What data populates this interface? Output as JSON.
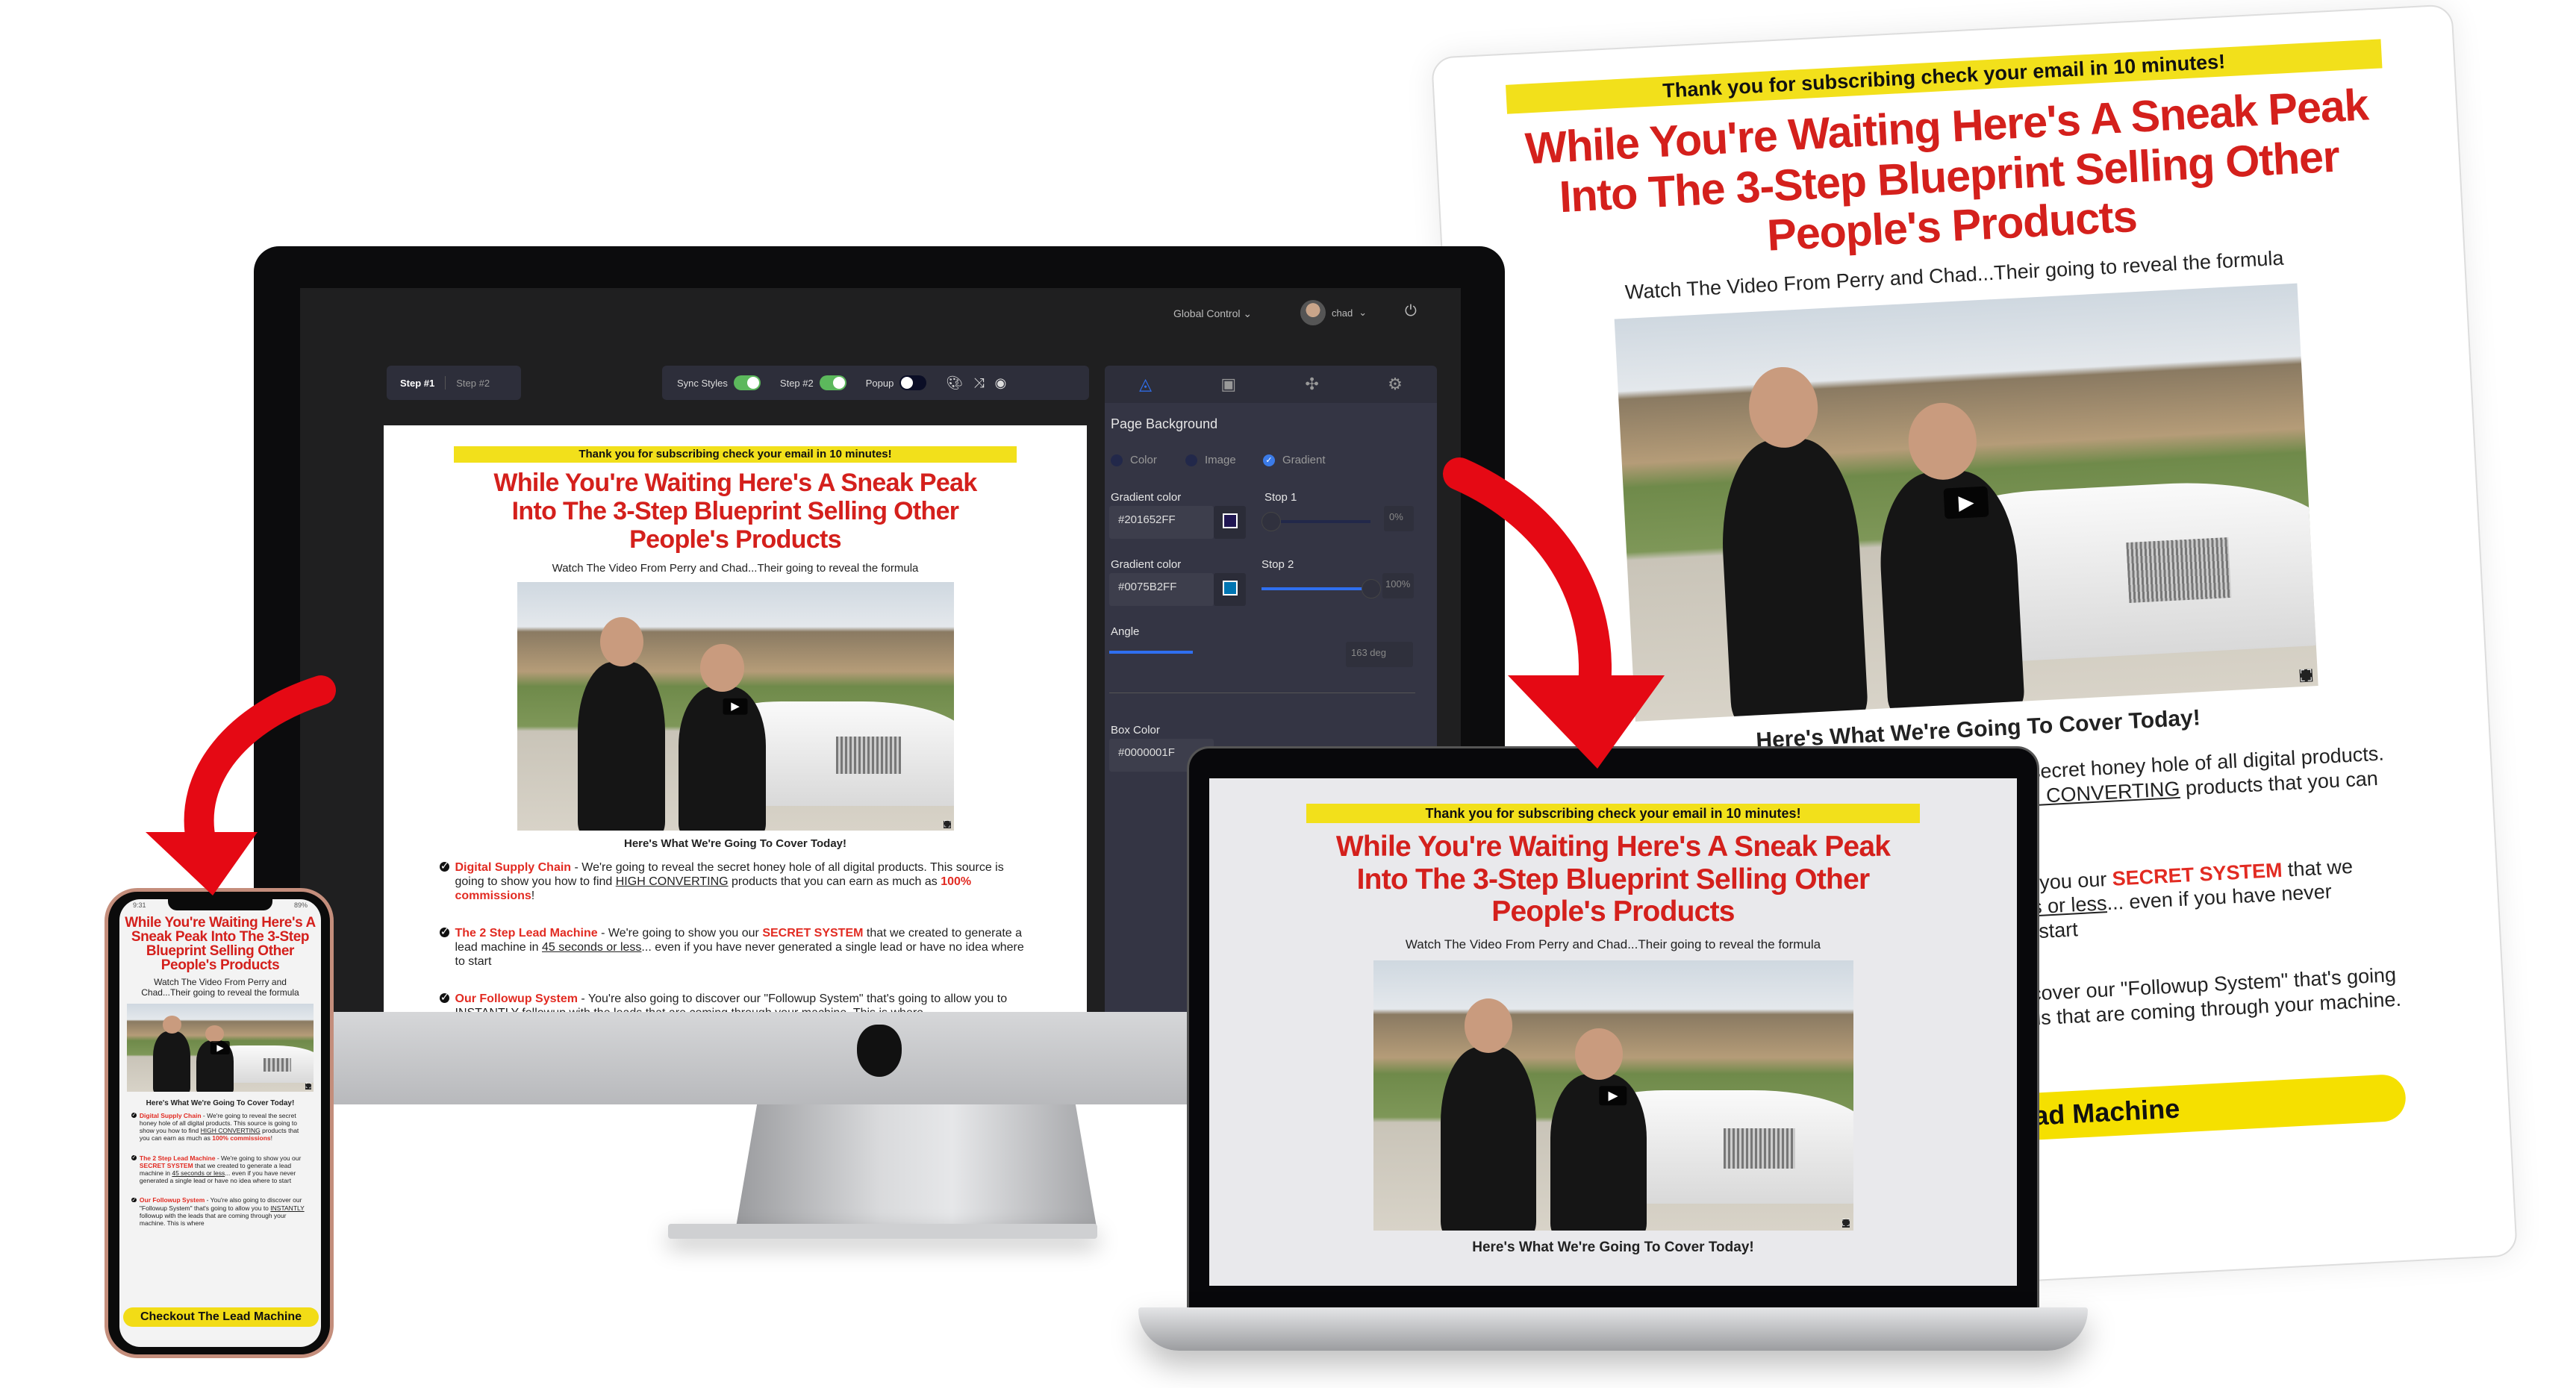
{
  "landing": {
    "thanks": "Thank you for subscribing check your email in 10 minutes!",
    "headline": "While You're Waiting Here's A Sneak Peak Into The 3-Step Blueprint Selling Other People's Products",
    "subtitle": "Watch The Video From Perry and Chad...Their going to reveal the formula",
    "cover_heading": "Here's What We're Going To Cover Today!",
    "bullets": [
      {
        "title": "Digital Supply Chain",
        "t1": " - We're going to reveal the secret honey hole of all digital products.  This source is going to show you how to find ",
        "u1": "HIGH CONVERTING",
        "t2": " products that you can earn as much as ",
        "r2": "100% commissions",
        "t3": "!"
      },
      {
        "title": "The 2 Step Lead Machine",
        "t1": " - We're going to show you our ",
        "r1": "SECRET SYSTEM",
        "t2": " that we created to generate a lead machine in ",
        "u2": "45 seconds or less",
        "t3": "... even if you have never generated a single lead or have no idea where to start"
      },
      {
        "title": "Our Followup System",
        "t1": " - You're also going to discover our \"Followup System\" that's going to allow you to ",
        "u1": "INSTANTLY",
        "t2": " followup with the leads that are coming through your machine.  This is where"
      }
    ],
    "cta": "Checkout The Lead Machine"
  },
  "editor": {
    "global_control": "Global Control",
    "user": "chad",
    "steps": [
      "Step #1",
      "Step #2"
    ],
    "toggles": [
      {
        "label": "Sync Styles",
        "on": true
      },
      {
        "label": "Step #2",
        "on": true
      },
      {
        "label": "Popup",
        "on": false
      }
    ],
    "toolbar_icons": [
      "palette-icon",
      "shuffle-icon",
      "eye-icon"
    ],
    "panel_tabs": [
      "fill-icon",
      "image-icon",
      "puzzle-icon",
      "gear-icon"
    ],
    "panel": {
      "title": "Page Background",
      "bg_types": [
        "Color",
        "Image",
        "Gradient"
      ],
      "selected_type": "Gradient",
      "gradient_color_label": "Gradient color",
      "color1": "#201652FF",
      "color1_swatch": "#201652",
      "stop1_label": "Stop 1",
      "stop1": "0%",
      "color2": "#0075B2FF",
      "color2_swatch": "#0075B2",
      "stop2_label": "Stop 2",
      "stop2": "100%",
      "angle_label": "Angle",
      "angle": "163 deg",
      "box_color_label": "Box Color",
      "box_color": "#0000001F"
    }
  },
  "phone": {
    "time": "9:31",
    "battery": "89%"
  },
  "colors": {
    "accent_red": "#d4201c",
    "highlight_yellow": "#f2e01b",
    "toggle_green": "#5cb85c",
    "editor_blue": "#2f6ff0"
  }
}
